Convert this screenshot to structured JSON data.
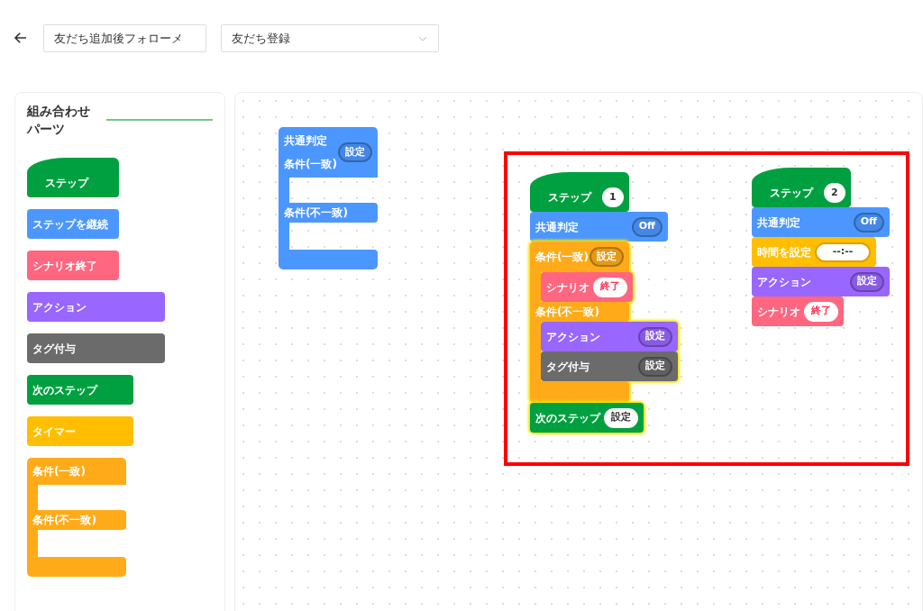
{
  "header": {
    "name_field": {
      "value": "友だち追加後フォローメ"
    },
    "trigger_select": {
      "value": "友だち登録"
    }
  },
  "palette": {
    "title": "組み合わせパーツ",
    "items": [
      {
        "kind": "hat",
        "label": "ステップ",
        "color": "#00a040"
      },
      {
        "kind": "block",
        "label": "ステップを継続",
        "color": "#4c97ff"
      },
      {
        "kind": "block",
        "label": "シナリオ終了",
        "color": "#ff6680"
      },
      {
        "kind": "block",
        "label": "アクション",
        "color": "#9966ff"
      },
      {
        "kind": "block",
        "label": "タグ付与",
        "color": "#6b6b6b"
      },
      {
        "kind": "block",
        "label": "次のステップ",
        "color": "#00a040"
      },
      {
        "kind": "block",
        "label": "タイマー",
        "color": "#ffbf00"
      },
      {
        "kind": "condition",
        "match_label": "条件(一致)",
        "mismatch_label": "条件(不一致)",
        "color": "#ffab19"
      }
    ]
  },
  "canvas": {
    "loose_block": {
      "kind": "condition",
      "color": "#4c97ff",
      "header_label": "共通判定",
      "match_label": "条件(一致)",
      "pill": {
        "kind": "outline",
        "text": "設定"
      },
      "mismatch_label": "条件(不一致)"
    },
    "selection": {
      "selected": true
    },
    "stacks": [
      {
        "blocks": [
          {
            "kind": "hat",
            "label": "ステップ",
            "color": "#00a040",
            "pill": {
              "kind": "white",
              "text": "1"
            }
          },
          {
            "kind": "block",
            "label": "共通判定",
            "color": "#4c97ff",
            "pill": {
              "kind": "outline",
              "text": "Off"
            }
          },
          {
            "kind": "condition",
            "color": "#ffab19",
            "highlighted": true,
            "match_label": "条件(一致)",
            "pill": {
              "kind": "outline",
              "text": "設定"
            },
            "mismatch_label": "条件(不一致)",
            "match_children": [
              {
                "kind": "block",
                "label": "シナリオ",
                "color": "#ff6680",
                "pill": {
                  "kind": "white",
                  "text": "終了",
                  "color": "#ff3355"
                }
              }
            ],
            "mismatch_children": [
              {
                "kind": "block",
                "label": "アクション",
                "color": "#9966ff",
                "pill": {
                  "kind": "outline",
                  "text": "設定"
                }
              },
              {
                "kind": "block",
                "label": "タグ付与",
                "color": "#6b6b6b",
                "pill": {
                  "kind": "outline",
                  "text": "設定"
                }
              }
            ]
          },
          {
            "kind": "block",
            "label": "次のステップ",
            "color": "#00a040",
            "highlighted": true,
            "pill": {
              "kind": "white",
              "text": "設定"
            }
          }
        ]
      },
      {
        "blocks": [
          {
            "kind": "hat",
            "label": "ステップ",
            "color": "#00a040",
            "pill": {
              "kind": "white",
              "text": "2"
            }
          },
          {
            "kind": "block",
            "label": "共通判定",
            "color": "#4c97ff",
            "pill": {
              "kind": "outline",
              "text": "Off"
            }
          },
          {
            "kind": "block",
            "label": "時間を設定",
            "color": "#ffbf00",
            "pill": {
              "kind": "field",
              "text": "--:--"
            }
          },
          {
            "kind": "block",
            "label": "アクション",
            "color": "#9966ff",
            "pill": {
              "kind": "outline",
              "text": "設定"
            }
          },
          {
            "kind": "block",
            "label": "シナリオ",
            "color": "#ff6680",
            "pill": {
              "kind": "white",
              "text": "終了",
              "color": "#ff3355"
            }
          }
        ]
      }
    ]
  }
}
